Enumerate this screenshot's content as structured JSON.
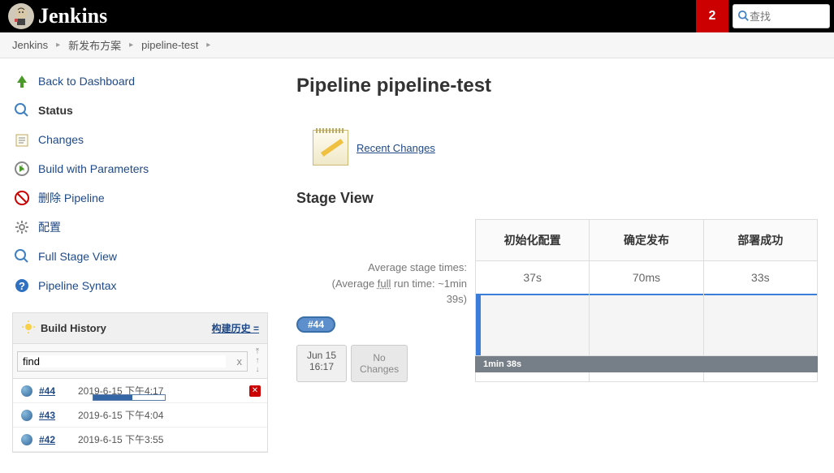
{
  "header": {
    "brand": "Jenkins",
    "notif_count": "2",
    "search_placeholder": "查找"
  },
  "breadcrumb": {
    "items": [
      "Jenkins",
      "新发布方案",
      "pipeline-test"
    ]
  },
  "sidebar": {
    "items": [
      {
        "label": "Back to Dashboard"
      },
      {
        "label": "Status"
      },
      {
        "label": "Changes"
      },
      {
        "label": "Build with Parameters"
      },
      {
        "label": "删除 Pipeline"
      },
      {
        "label": "配置"
      },
      {
        "label": "Full Stage View"
      },
      {
        "label": "Pipeline Syntax"
      }
    ]
  },
  "build_history": {
    "title": "Build History",
    "trend_label": "构建历史 =",
    "search_value": "find",
    "items": [
      {
        "num": "#44",
        "date": "2019-6-15 下午4:17",
        "running": true,
        "progress_pct": 55
      },
      {
        "num": "#43",
        "date": "2019-6-15 下午4:04",
        "running": false
      },
      {
        "num": "#42",
        "date": "2019-6-15 下午3:55",
        "running": false
      }
    ]
  },
  "content": {
    "page_title": "Pipeline pipeline-test",
    "recent_changes_label": "Recent Changes",
    "stage_view_title": "Stage View",
    "avg_label_line1": "Average stage times:",
    "avg_label_line2a": "(Average ",
    "avg_label_line2b": "full",
    "avg_label_line2c": " run time: ~1min",
    "avg_label_line3": "39s)",
    "current_build": {
      "badge": "#44",
      "date": "Jun 15",
      "time": "16:17",
      "no_changes": "No\nChanges"
    },
    "stages": [
      {
        "name": "初始化配置",
        "avg": "37s"
      },
      {
        "name": "确定发布",
        "avg": "70ms"
      },
      {
        "name": "部署成功",
        "avg": "33s"
      }
    ],
    "total_time": "1min 38s"
  }
}
